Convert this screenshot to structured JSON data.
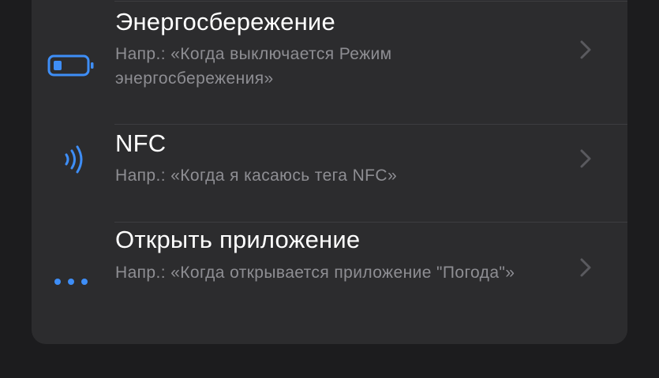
{
  "colors": {
    "background": "#1c1c1e",
    "card": "#2c2c2e",
    "accent": "#3e8ef7",
    "title": "#ffffff",
    "subtitle": "#8e8e93",
    "chevron": "#5a5a5f"
  },
  "rows": [
    {
      "icon": "battery-icon",
      "title": "Энергосбережение",
      "subtitle": "Напр.: «Когда выключается Режим энергосбережения»"
    },
    {
      "icon": "nfc-icon",
      "title": "NFC",
      "subtitle": "Напр.: «Когда я касаюсь тега NFC»"
    },
    {
      "icon": "more-icon",
      "title": "Открыть приложение",
      "subtitle": "Напр.: «Когда открывается приложение \"Погода\"»"
    }
  ]
}
